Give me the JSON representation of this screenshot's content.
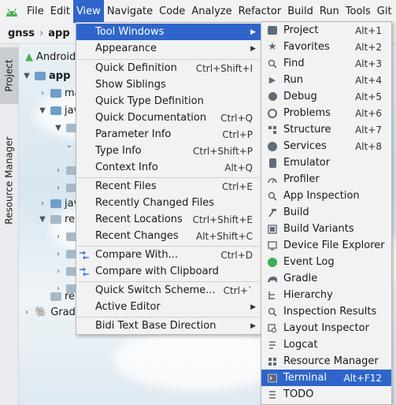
{
  "menubar": {
    "items": [
      "File",
      "Edit",
      "View",
      "Navigate",
      "Code",
      "Analyze",
      "Refactor",
      "Build",
      "Run",
      "Tools",
      "Git"
    ],
    "active": "View"
  },
  "breadcrumb": {
    "items": [
      "gnss",
      "app"
    ]
  },
  "tool_strip": {
    "project": "Project",
    "resource_manager": "Resource Manager"
  },
  "project_tree": {
    "rows": [
      "Android",
      "app",
      "ma",
      "jav",
      "jav",
      "re",
      "re",
      "Grad"
    ]
  },
  "view_menu": {
    "items": [
      {
        "label": "Tool Windows",
        "shortcut": "",
        "submenu": true,
        "active": true
      },
      {
        "label": "Appearance",
        "shortcut": "",
        "submenu": true
      },
      {
        "label": "Quick Definition",
        "shortcut": "Ctrl+Shift+I"
      },
      {
        "label": "Show Siblings",
        "shortcut": ""
      },
      {
        "label": "Quick Type Definition",
        "shortcut": ""
      },
      {
        "label": "Quick Documentation",
        "shortcut": "Ctrl+Q"
      },
      {
        "label": "Parameter Info",
        "shortcut": "Ctrl+P"
      },
      {
        "label": "Type Info",
        "shortcut": "Ctrl+Shift+P"
      },
      {
        "label": "Context Info",
        "shortcut": "Alt+Q"
      },
      {
        "label": "Recent Files",
        "shortcut": "Ctrl+E"
      },
      {
        "label": "Recently Changed Files",
        "shortcut": ""
      },
      {
        "label": "Recent Locations",
        "shortcut": "Ctrl+Shift+E"
      },
      {
        "label": "Recent Changes",
        "shortcut": "Alt+Shift+C"
      },
      {
        "label": "Compare With...",
        "shortcut": "Ctrl+D"
      },
      {
        "label": "Compare with Clipboard",
        "shortcut": ""
      },
      {
        "label": "Quick Switch Scheme...",
        "shortcut": "Ctrl+`"
      },
      {
        "label": "Active Editor",
        "shortcut": "",
        "submenu": true
      },
      {
        "label": "Bidi Text Base Direction",
        "shortcut": "",
        "submenu": true
      }
    ]
  },
  "tool_windows_menu": {
    "items": [
      {
        "label": "Project",
        "shortcut": "Alt+1",
        "icon": "folder-icon"
      },
      {
        "label": "Favorites",
        "shortcut": "Alt+2",
        "icon": "star-icon"
      },
      {
        "label": "Find",
        "shortcut": "Alt+3",
        "icon": "search-icon"
      },
      {
        "label": "Run",
        "shortcut": "Alt+4",
        "icon": "play-icon"
      },
      {
        "label": "Debug",
        "shortcut": "Alt+5",
        "icon": "bug-icon"
      },
      {
        "label": "Problems",
        "shortcut": "Alt+6",
        "icon": "problems-icon"
      },
      {
        "label": "Structure",
        "shortcut": "Alt+7",
        "icon": "structure-icon"
      },
      {
        "label": "Services",
        "shortcut": "Alt+8",
        "icon": "services-icon"
      },
      {
        "label": "Emulator",
        "shortcut": "",
        "icon": "emulator-icon"
      },
      {
        "label": "Profiler",
        "shortcut": "",
        "icon": "profiler-icon"
      },
      {
        "label": "App Inspection",
        "shortcut": "",
        "icon": "inspection-icon"
      },
      {
        "label": "Build",
        "shortcut": "",
        "icon": "hammer-icon"
      },
      {
        "label": "Build Variants",
        "shortcut": "",
        "icon": "build-variants-icon"
      },
      {
        "label": "Device File Explorer",
        "shortcut": "",
        "icon": "device-icon"
      },
      {
        "label": "Event Log",
        "shortcut": "",
        "icon": "event-log-icon"
      },
      {
        "label": "Gradle",
        "shortcut": "",
        "icon": "gradle-icon"
      },
      {
        "label": "Hierarchy",
        "shortcut": "",
        "icon": "hierarchy-icon"
      },
      {
        "label": "Inspection Results",
        "shortcut": "",
        "icon": "inspection-results-icon"
      },
      {
        "label": "Layout Inspector",
        "shortcut": "",
        "icon": "layout-inspector-icon"
      },
      {
        "label": "Logcat",
        "shortcut": "",
        "icon": "logcat-icon"
      },
      {
        "label": "Resource Manager",
        "shortcut": "",
        "icon": "resource-manager-icon"
      },
      {
        "label": "Terminal",
        "shortcut": "Alt+F12",
        "icon": "terminal-icon",
        "active": true
      },
      {
        "label": "TODO",
        "shortcut": "",
        "icon": "todo-icon"
      }
    ]
  },
  "colors": {
    "accent": "#2f65ca",
    "menu_bg": "#f2f2f2",
    "event_log_green": "#3fae59"
  }
}
